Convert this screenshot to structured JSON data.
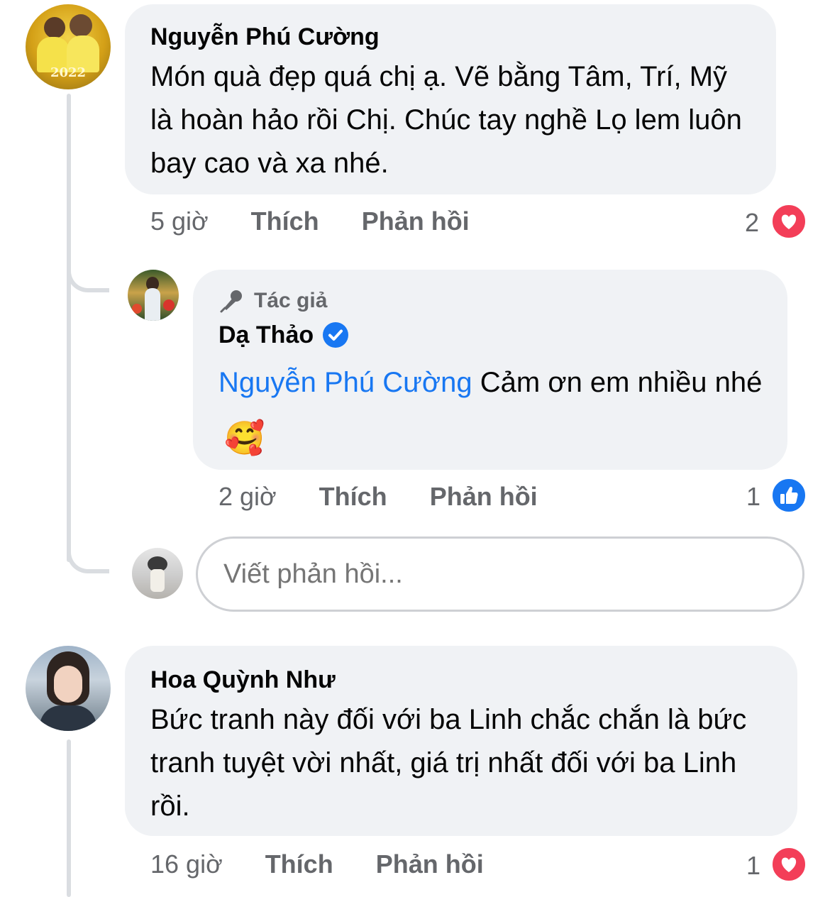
{
  "comments": [
    {
      "author": "Nguyễn Phú Cường",
      "avatar_text": "2022",
      "text": "Món quà đẹp quá chị ạ. Vẽ bằng Tâm, Trí, Mỹ là hoàn hảo rồi Chị. Chúc tay nghề Lọ lem luôn bay cao và xa nhé.",
      "time": "5 giờ",
      "like_label": "Thích",
      "reply_label": "Phản hồi",
      "reaction_count": "2",
      "reaction_icon": "heart-icon",
      "reaction_color": "#f33e58"
    },
    {
      "author": "Hoa Quỳnh Như",
      "text": "Bức tranh này đối với ba Linh chắc chắn là bức tranh tuyệt vời nhất, giá trị nhất đối với ba Linh rồi.",
      "time": "16 giờ",
      "like_label": "Thích",
      "reply_label": "Phản hồi",
      "reaction_count": "1",
      "reaction_icon": "heart-icon",
      "reaction_color": "#f33e58"
    }
  ],
  "reply": {
    "badge_label": "Tác giả",
    "badge_icon": "microphone-icon",
    "author": "Dạ Thảo",
    "verified_icon": "verified-badge-icon",
    "mention": "Nguyễn Phú Cường",
    "text": " Cảm ơn em nhiều nhé",
    "emoji": "🥰",
    "time": "2 giờ",
    "like_label": "Thích",
    "reply_label": "Phản hồi",
    "reaction_count": "1",
    "reaction_icon": "like-icon",
    "reaction_color": "#1877f2"
  },
  "reply_input": {
    "placeholder": "Viết phản hồi..."
  },
  "colors": {
    "bubble": "#f0f2f5",
    "link": "#1877f2",
    "meta": "#65676b"
  }
}
